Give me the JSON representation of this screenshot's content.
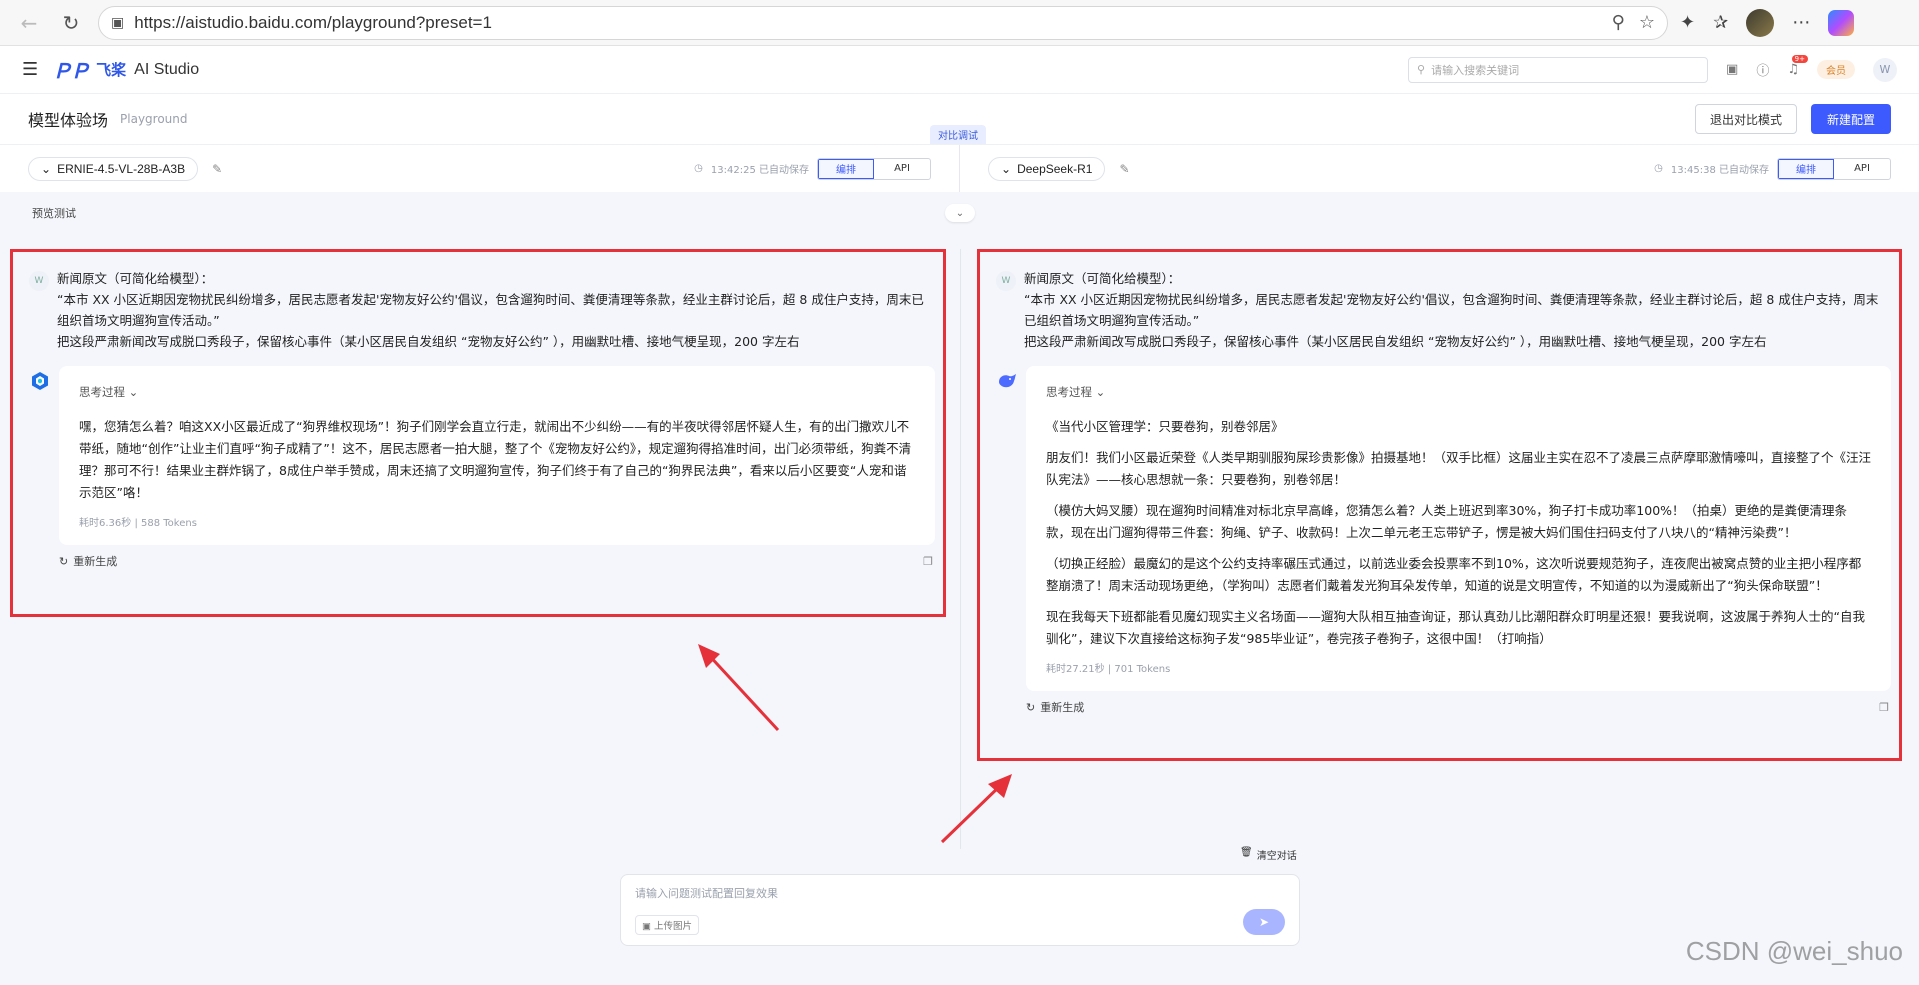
{
  "browser": {
    "url": "https://aistudio.baidu.com/playground?preset=1"
  },
  "app": {
    "brand_cn": "飞桨",
    "brand_en": "AI Studio",
    "search_placeholder": "请输入搜索关键词",
    "notification_badge": "9+",
    "vip_label": "会员",
    "user_initial": "W"
  },
  "page": {
    "title": "模型体验场",
    "subtitle": "Playground",
    "compare_tag": "对比调试",
    "exit_compare": "退出对比模式",
    "new_config": "新建配置",
    "preview_label": "预览测试",
    "clear_chat": "清空对话",
    "input_placeholder": "请输入问题测试配置回复效果",
    "upload_label": "上传图片",
    "watermark": "CSDN @wei_shuo"
  },
  "left": {
    "model": "ERNIE-4.5-VL-28B-A3B",
    "autosave": "13:42:25 已自动保存",
    "tab_edit": "编排",
    "tab_api": "API",
    "user_initial": "W",
    "user_line1": "新闻原文（可简化给模型）：",
    "user_line2": "“本市 XX 小区近期因宠物扰民纠纷增多，居民志愿者发起'宠物友好公约'倡议，包含遛狗时间、粪便清理等条款，经业主群讨论后，超 8 成住户支持，周末已组织首场文明遛狗宣传活动。”",
    "user_line3": "把这段严肃新闻改写成脱口秀段子，保留核心事件（某小区居民自发组织 “宠物友好公约” ），用幽默吐槽、接地气梗呈现，200 字左右",
    "think": "思考过程",
    "reply": "嘿，您猜怎么着？咱这XX小区最近成了“狗界维权现场”！狗子们刚学会直立行走，就闹出不少纠纷——有的半夜吠得邻居怀疑人生，有的出门撒欢儿不带纸，随地“创作”让业主们直呼“狗子成精了”！这不，居民志愿者一拍大腿，整了个《宠物友好公约》，规定遛狗得掐准时间，出门必须带纸，狗粪不清理？那可不行！结果业主群炸锅了，8成住户举手赞成，周末还搞了文明遛狗宣传，狗子们终于有了自己的“狗界民法典”，看来以后小区要变“人宠和谐示范区”咯！",
    "meta": "耗时6.36秒 | 588 Tokens",
    "regen": "重新生成"
  },
  "right": {
    "model": "DeepSeek-R1",
    "autosave": "13:45:38 已自动保存",
    "tab_edit": "编排",
    "tab_api": "API",
    "user_initial": "W",
    "user_line1": "新闻原文（可简化给模型）：",
    "user_line2": "“本市 XX 小区近期因宠物扰民纠纷增多，居民志愿者发起'宠物友好公约'倡议，包含遛狗时间、粪便清理等条款，经业主群讨论后，超 8 成住户支持，周末已组织首场文明遛狗宣传活动。”",
    "user_line3": "把这段严肃新闻改写成脱口秀段子，保留核心事件（某小区居民自发组织 “宠物友好公约” ），用幽默吐槽、接地气梗呈现，200 字左右",
    "think": "思考过程",
    "paragraphs": [
      "《当代小区管理学：只要卷狗，别卷邻居》",
      "朋友们！我们小区最近荣登《人类早期驯服狗屎珍贵影像》拍摄基地！（双手比框）这届业主实在忍不了凌晨三点萨摩耶激情嚎叫，直接整了个《汪汪队宪法》——核心思想就一条：只要卷狗，别卷邻居！",
      "（模仿大妈叉腰）现在遛狗时间精准对标北京早高峰，您猜怎么着？人类上班迟到率30%，狗子打卡成功率100%！（拍桌）更绝的是粪便清理条款，现在出门遛狗得带三件套：狗绳、铲子、收款码！上次二单元老王忘带铲子，愣是被大妈们围住扫码支付了八块八的“精神污染费”！",
      "（切换正经脸）最魔幻的是这个公约支持率碾压式通过，以前选业委会投票率不到10%，这次听说要规范狗子，连夜爬出被窝点赞的业主把小程序都整崩溃了！周末活动现场更绝，（学狗叫）志愿者们戴着发光狗耳朵发传单，知道的说是文明宣传，不知道的以为漫威新出了“狗头保命联盟”！",
      "现在我每天下班都能看见魔幻现实主义名场面——遛狗大队相互抽查询证，那认真劲儿比潮阳群众盯明星还狠！要我说啊，这波属于养狗人士的“自我驯化”，建议下次直接给这标狗子发“985毕业证”，卷完孩子卷狗子，这很中国！（打响指）"
    ],
    "meta": "耗时27.21秒 | 701 Tokens",
    "regen": "重新生成"
  },
  "colors": {
    "accent": "#3d5afe",
    "highlight_red": "#e5313a"
  }
}
